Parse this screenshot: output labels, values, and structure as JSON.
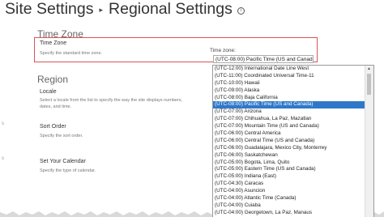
{
  "header": {
    "breadcrumb_root": "Site Settings",
    "separator": "▸",
    "page_title": "Regional Settings",
    "info_icon_glyph": "i"
  },
  "sections": {
    "time_zone_group": "Time Zone",
    "time_zone": {
      "title": "Time Zone",
      "description": "Specify the standard time zone.",
      "field_label": "Time zone:",
      "selected_value": "(UTC-08:00) Pacific Time (US and Canada)"
    },
    "region_group": "Region",
    "locale": {
      "title": "Locale",
      "description_line1": "Select a locale from the list to specify the way the site displays numbers,",
      "description_line2": "dates, and time."
    },
    "sort_order": {
      "title": "Sort Order",
      "description": "Specify the sort order."
    },
    "calendar": {
      "title": "Set Your Calendar",
      "description": "Specify the type of calendar."
    }
  },
  "left_marks": [
    "s",
    "s"
  ],
  "timezone_options": [
    "(UTC-12:00) International Date Line West",
    "(UTC-11:00) Coordinated Universal Time-11",
    "(UTC-10:00) Hawaii",
    "(UTC-09:00) Alaska",
    "(UTC-08:00) Baja California",
    "(UTC-08:00) Pacific Time (US and Canada)",
    "(UTC-07:00) Arizona",
    "(UTC-07:00) Chihuahua, La Paz, Mazatlan",
    "(UTC-07:00) Mountain Time (US and Canada)",
    "(UTC-06:00) Central America",
    "(UTC-06:00) Central Time (US and Canada)",
    "(UTC-06:00) Guadalajara, Mexico City, Monterrey",
    "(UTC-06:00) Saskatchewan",
    "(UTC-05:00) Bogota, Lima, Quito",
    "(UTC-05:00) Eastern Time (US and Canada)",
    "(UTC-05:00) Indiana (East)",
    "(UTC-04:30) Caracas",
    "(UTC-04:00) Asuncion",
    "(UTC-04:00) Atlantic Time (Canada)",
    "(UTC-04:00) Cuiaba",
    "(UTC-04:00) Georgetown, La Paz, Manaus"
  ],
  "selected_option_index": 5,
  "colors": {
    "highlight_border": "#d9535a",
    "selected_option_bg": "#2f78c9"
  },
  "scrollbar_icon": "up-arrow-icon"
}
